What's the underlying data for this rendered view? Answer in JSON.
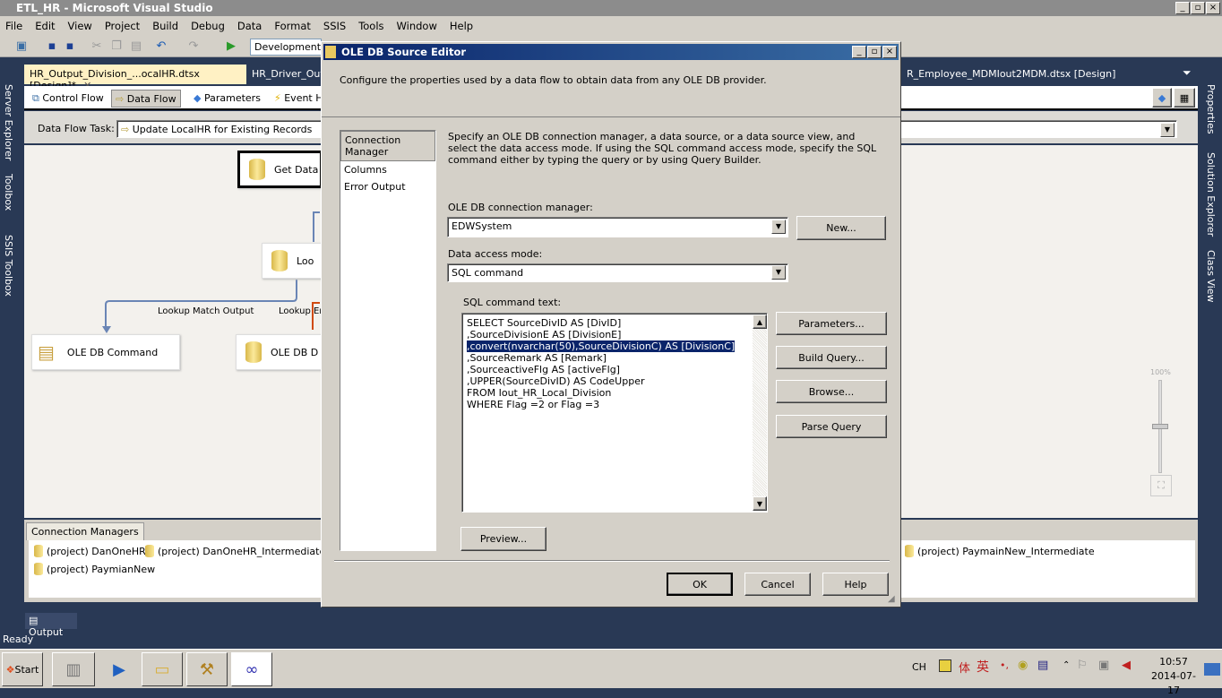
{
  "window": {
    "title": "ETL_HR - Microsoft Visual Studio",
    "controls": [
      "_",
      "▫",
      "×"
    ]
  },
  "menu": [
    "File",
    "Edit",
    "View",
    "Project",
    "Build",
    "Debug",
    "Data",
    "Format",
    "SSIS",
    "Tools",
    "Window",
    "Help"
  ],
  "toolbar": {
    "configuration": "Development"
  },
  "left_strip": [
    "Server Explorer",
    "Toolbox",
    "SSIS Toolbox"
  ],
  "right_strip": [
    "Properties",
    "Solution Explorer",
    "Class View"
  ],
  "doc_tabs": [
    {
      "label": "HR_Output_Division_...ocalHR.dtsx [Design]*",
      "active": true
    },
    {
      "label": "HR_Driver_Outp",
      "active": false
    },
    {
      "label": "R_Employee_MDMIout2MDM.dtsx [Design]",
      "active": false
    }
  ],
  "designer_tabs": [
    "Control Flow",
    "Data Flow",
    "Parameters",
    "Event H"
  ],
  "data_flow_task": {
    "label": "Data Flow Task:",
    "value": "Update LocalHR for Existing Records"
  },
  "canvas": {
    "components": [
      "Get Data",
      "Lookup",
      "OLE DB Command",
      "OLE DB D"
    ],
    "paths": [
      "Lookup Match Output",
      "Lookup Er"
    ],
    "zoom": "100%"
  },
  "connection_managers": {
    "tab": "Connection Managers",
    "items": [
      "(project) DanOneHR",
      "(project) DanOneHR_Intermediate",
      "(project) PaymainNew_Intermediate",
      "(project) PaymianNew"
    ]
  },
  "output_tab": "Output",
  "status": "Ready",
  "dialog": {
    "title": "OLE DB Source Editor",
    "description": "Configure the properties used by a data flow to obtain data from any OLE DB provider.",
    "nav": [
      "Connection Manager",
      "Columns",
      "Error Output"
    ],
    "instructions": "Specify an OLE DB connection manager, a data source, or a data source view, and select the data access mode. If using the SQL command access mode, specify the SQL command either by typing the query or by using Query Builder.",
    "conn_label": "OLE DB connection manager:",
    "conn_value": "EDWSystem",
    "new_button": "New...",
    "mode_label": "Data access mode:",
    "mode_value": "SQL command",
    "sql_label": "SQL command text:",
    "sql_lines": [
      "SELECT SourceDivID AS [DivID]",
      ",SourceDivisionE AS [DivisionE]",
      ",convert(nvarchar(50),SourceDivisionC) AS [DivisionC]",
      ",SourceRemark AS [Remark]",
      ",SourceactiveFlg AS [activeFlg]",
      ",UPPER(SourceDivID) AS CodeUpper",
      "FROM Iout_HR_Local_Division",
      "WHERE Flag =2 or Flag =3"
    ],
    "buttons": {
      "parameters": "Parameters...",
      "build_query": "Build Query...",
      "browse": "Browse...",
      "parse_query": "Parse Query",
      "preview": "Preview...",
      "ok": "OK",
      "cancel": "Cancel",
      "help": "Help"
    }
  },
  "taskbar": {
    "start": "Start",
    "lang": "CH",
    "ime": "英",
    "time": "10:57",
    "date": "2014-07-17"
  }
}
